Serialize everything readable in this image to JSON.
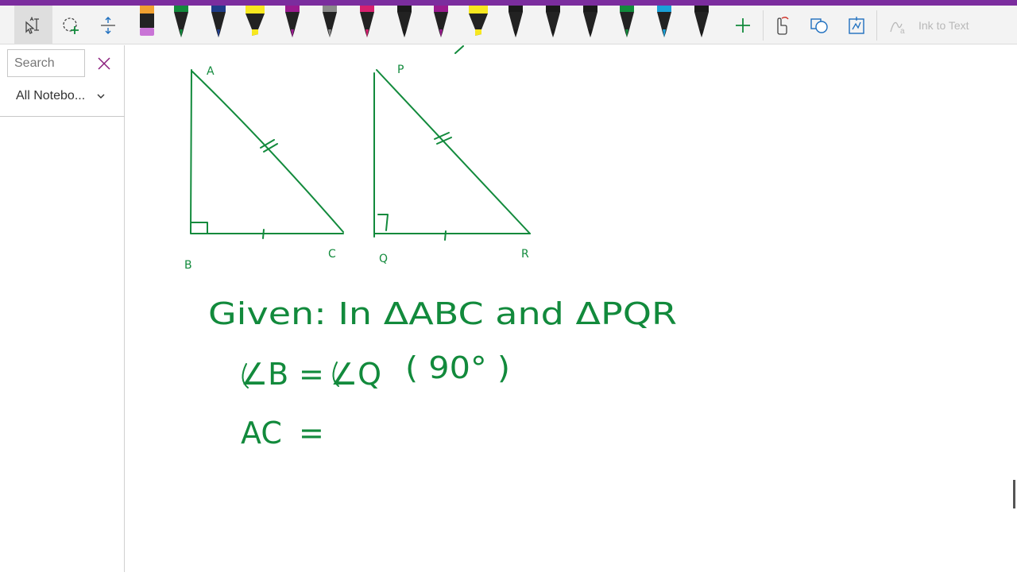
{
  "toolbar": {
    "tools": [
      {
        "name": "type-select-icon",
        "active": true
      },
      {
        "name": "lasso-select-icon",
        "active": false
      },
      {
        "name": "add-space-icon",
        "active": false
      }
    ],
    "pens": [
      {
        "type": "eraser",
        "color": "#c974d6"
      },
      {
        "type": "pen",
        "color": "#128a3c"
      },
      {
        "type": "pen",
        "color": "#1f3c88"
      },
      {
        "type": "highlighter",
        "color": "#f7e71f"
      },
      {
        "type": "pen",
        "color": "#9a1a8f"
      },
      {
        "type": "pen",
        "color": "#8a8a8a"
      },
      {
        "type": "pen",
        "color": "#d6206f"
      },
      {
        "type": "pen",
        "color": "#1a1a1a"
      },
      {
        "type": "pen",
        "color": "#9a1a8f"
      },
      {
        "type": "highlighter",
        "color": "#f7e71f"
      },
      {
        "type": "pen",
        "color": "#1a1a1a"
      },
      {
        "type": "pen",
        "color": "#1a1a1a"
      },
      {
        "type": "pen",
        "color": "#1a1a1a"
      },
      {
        "type": "pen",
        "color": "#128a3c"
      },
      {
        "type": "pen",
        "color": "#1aa0d8"
      },
      {
        "type": "pen",
        "color": "#1a1a1a"
      }
    ],
    "ink_to_text_label": "Ink to Text"
  },
  "sidebar": {
    "search_placeholder": "Search",
    "notebook_filter": "All Notebo..."
  },
  "ink_color": "#128a3c",
  "handwriting": {
    "triangle1": {
      "A": "A",
      "B": "B",
      "C": "C"
    },
    "triangle2": {
      "P": "P",
      "Q": "Q",
      "R": "R"
    },
    "line1": "Given: In ΔABC and ΔPQR",
    "line2_left": "∠B",
    "line2_eq": "=",
    "line2_right": "∠Q",
    "line2_note": "( 90° )",
    "line3_left": "AC",
    "line3_eq": "="
  }
}
